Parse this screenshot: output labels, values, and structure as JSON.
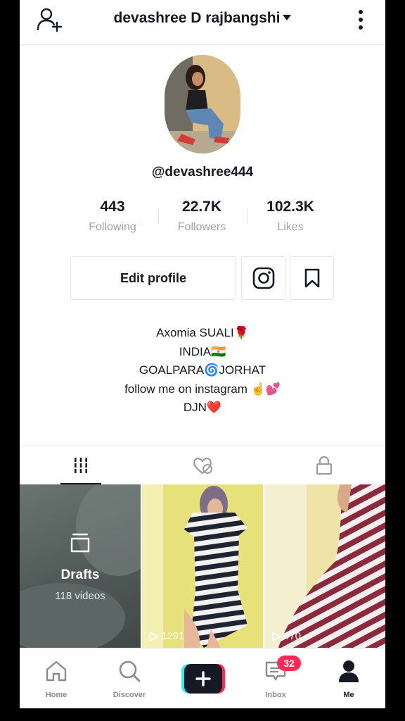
{
  "header": {
    "username": "devashree D rajbangshi",
    "add_user_icon": "add-user-icon",
    "more_icon": "more-vertical-icon"
  },
  "profile": {
    "handle": "@devashree444",
    "stats": [
      {
        "value": "443",
        "label": "Following"
      },
      {
        "value": "22.7K",
        "label": "Followers"
      },
      {
        "value": "102.3K",
        "label": "Likes"
      }
    ],
    "edit_profile_label": "Edit profile",
    "bio_lines": [
      "Axomia SUALI🌹",
      "INDIA🇮🇳",
      "GOALPARA🌀JORHAT",
      "follow me on instagram ☝️💕",
      "DJN❤️"
    ]
  },
  "tabs": [
    {
      "icon": "videos-grid-icon",
      "active": true
    },
    {
      "icon": "liked-hidden-icon",
      "active": false
    },
    {
      "icon": "lock-icon",
      "active": false
    }
  ],
  "grid": {
    "drafts": {
      "title": "Drafts",
      "count": "118 videos"
    },
    "videos": [
      {
        "views": "1291"
      },
      {
        "views": "470"
      }
    ]
  },
  "bottom_nav": {
    "items": [
      {
        "label": "Home",
        "icon": "home-icon"
      },
      {
        "label": "Discover",
        "icon": "search-icon"
      },
      {
        "label": "",
        "icon": "create-plus-icon"
      },
      {
        "label": "Inbox",
        "icon": "inbox-icon"
      },
      {
        "label": "Me",
        "icon": "profile-icon"
      }
    ],
    "inbox_badge": "32"
  },
  "colors": {
    "accent": "#fe2c55",
    "cyan": "#25f4ee",
    "text": "#161823",
    "muted": "#a1a2a7"
  }
}
